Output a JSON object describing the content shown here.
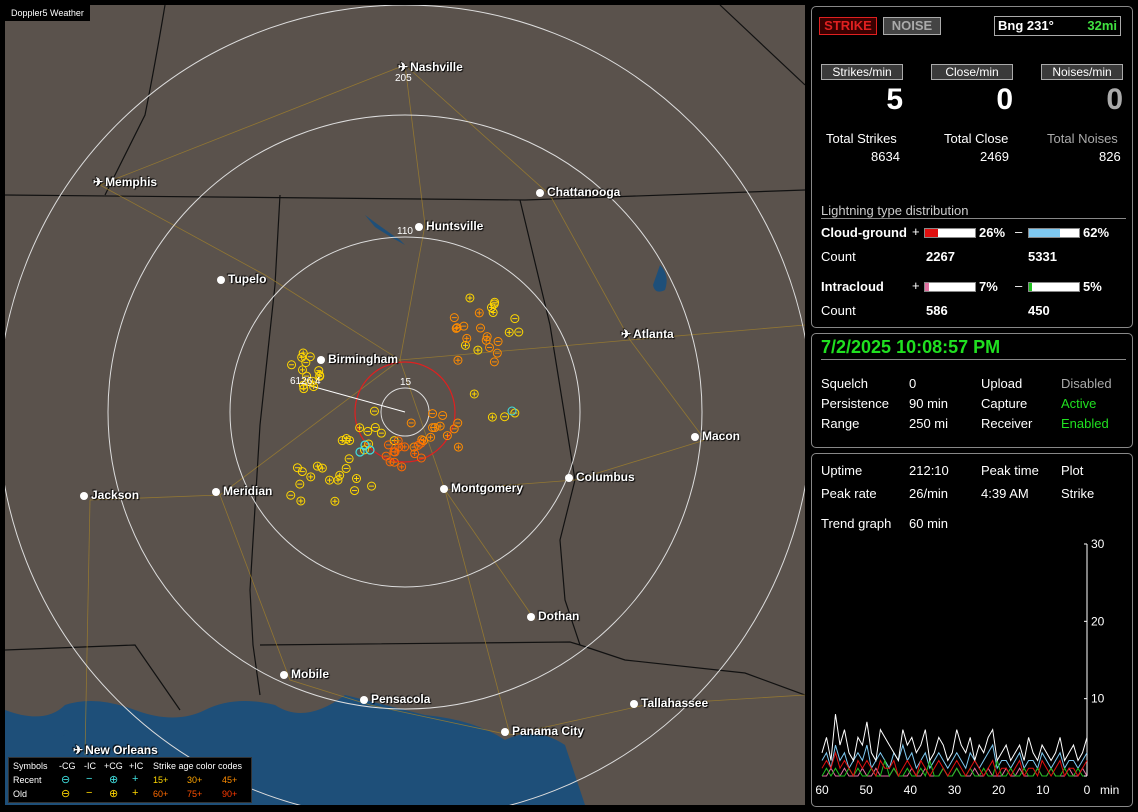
{
  "map": {
    "title": "Doppler5 Weather",
    "cities": [
      {
        "name": "Nashville",
        "kind": "airport"
      },
      {
        "name": "Memphis",
        "kind": "airport"
      },
      {
        "name": "Chattanooga",
        "kind": "city"
      },
      {
        "name": "Huntsville",
        "kind": "city"
      },
      {
        "name": "Tupelo",
        "kind": "city"
      },
      {
        "name": "Atlanta",
        "kind": "airport"
      },
      {
        "name": "Birmingham",
        "kind": "city"
      },
      {
        "name": "Macon",
        "kind": "city"
      },
      {
        "name": "Columbus",
        "kind": "city"
      },
      {
        "name": "Montgomery",
        "kind": "city"
      },
      {
        "name": "Meridian",
        "kind": "city"
      },
      {
        "name": "Jackson",
        "kind": "city"
      },
      {
        "name": "Dothan",
        "kind": "city"
      },
      {
        "name": "Mobile",
        "kind": "city"
      },
      {
        "name": "Pensacola",
        "kind": "city"
      },
      {
        "name": "Tallahassee",
        "kind": "city"
      },
      {
        "name": "Panama City",
        "kind": "city"
      },
      {
        "name": "New Orleans",
        "kind": "airport"
      }
    ],
    "ring_labels": [
      "205",
      "110",
      "15"
    ],
    "bearing_label": "6126.4",
    "legend": {
      "symbols": "Symbols",
      "headers": [
        "-CG",
        "-IC",
        "+CG",
        "+IC"
      ],
      "age_title": "Strike age color codes",
      "recent": "Recent",
      "old": "Old",
      "recent_ages": [
        "15+",
        "30+",
        "45+"
      ],
      "old_ages": [
        "60+",
        "75+",
        "90+"
      ],
      "age_colors": [
        "#ffd700",
        "#ffa500",
        "#ff8c00",
        "#ff6a00",
        "#ff5000",
        "#ff3a00"
      ]
    }
  },
  "status": {
    "strike_button": "STRIKE",
    "noise_button": "NOISE",
    "bearing": "Bng 231°",
    "distance": "32mi",
    "strikes_per_min_label": "Strikes/min",
    "close_per_min_label": "Close/min",
    "noises_per_min_label": "Noises/min",
    "strikes_per_min": "5",
    "close_per_min": "0",
    "noises_per_min": "0",
    "total_strikes_label": "Total Strikes",
    "total_close_label": "Total Close",
    "total_noises_label": "Total Noises",
    "total_strikes": "8634",
    "total_close": "2469",
    "total_noises": "826"
  },
  "distribution": {
    "title": "Lightning type distribution",
    "cloud_ground_label": "Cloud-ground",
    "intracloud_label": "Intracloud",
    "count_label": "Count",
    "plus": "+",
    "minus": "–",
    "cg_pos_pct_text": "26%",
    "cg_neg_pct_text": "62%",
    "ic_pos_pct_text": "7%",
    "ic_neg_pct_text": "5%",
    "cg_pos_pct": 26,
    "cg_neg_pct": 62,
    "ic_pos_pct": 7,
    "ic_neg_pct": 5,
    "cg_pos_count": "2267",
    "cg_neg_count": "5331",
    "ic_pos_count": "586",
    "ic_neg_count": "450",
    "colors": {
      "cg_pos": "#e01010",
      "cg_neg": "#7ec8f0",
      "ic_pos": "#e070a0",
      "ic_neg": "#20c020"
    }
  },
  "settings": {
    "datetime": "7/2/2025 10:08:57 PM",
    "squelch_label": "Squelch",
    "squelch": "0",
    "persistence_label": "Persistence",
    "persistence": "90 min",
    "range_label": "Range",
    "range": "250 mi",
    "upload_label": "Upload",
    "upload": "Disabled",
    "capture_label": "Capture",
    "capture": "Active",
    "receiver_label": "Receiver",
    "receiver": "Enabled"
  },
  "stats": {
    "uptime_label": "Uptime",
    "uptime": "212:10",
    "peak_time_label": "Peak time",
    "peak_time": "4:39 AM",
    "plot_label": "Plot",
    "plot": "Strike",
    "peak_rate_label": "Peak rate",
    "peak_rate": "26/min",
    "trend_label": "Trend graph",
    "trend": "60 min",
    "y_ticks": [
      "30",
      "20",
      "10",
      "0"
    ],
    "x_ticks": [
      "60",
      "50",
      "40",
      "30",
      "20",
      "10",
      "0"
    ],
    "x_unit": "min"
  },
  "chart_data": {
    "type": "line",
    "title": "",
    "xlabel": "min",
    "ylabel": "",
    "x_range": [
      60,
      0
    ],
    "ylim": [
      0,
      30
    ],
    "series": [
      {
        "color": "#ffffff",
        "values": [
          3,
          5,
          2,
          8,
          4,
          6,
          3,
          2,
          5,
          4,
          7,
          3,
          2,
          6,
          5,
          4,
          3,
          2,
          6,
          4,
          5,
          3,
          4,
          6,
          2,
          3,
          5,
          4,
          2,
          3,
          6,
          4,
          3,
          5,
          2,
          4,
          3,
          5,
          6,
          2,
          3,
          4,
          2,
          3,
          4,
          2,
          5,
          3,
          2,
          4,
          3,
          2,
          3,
          5,
          2,
          3,
          4,
          2,
          3,
          5
        ]
      },
      {
        "color": "#e01010",
        "values": [
          1,
          2,
          1,
          3,
          1,
          2,
          1,
          0,
          2,
          1,
          2,
          1,
          0,
          2,
          1,
          1,
          2,
          0,
          1,
          2,
          1,
          0,
          2,
          1,
          0,
          1,
          2,
          1,
          0,
          1,
          2,
          1,
          0,
          1,
          2,
          1,
          0,
          1,
          2,
          0,
          1,
          1,
          0,
          1,
          2,
          0,
          1,
          1,
          0,
          2,
          1,
          0,
          1,
          2,
          0,
          1,
          1,
          0,
          1,
          2
        ]
      },
      {
        "color": "#20c020",
        "values": [
          0,
          1,
          0,
          1,
          0,
          0,
          1,
          0,
          1,
          0,
          0,
          1,
          0,
          0,
          2,
          0,
          1,
          0,
          0,
          1,
          0,
          0,
          1,
          0,
          2,
          0,
          0,
          1,
          0,
          0,
          1,
          0,
          0,
          1,
          0,
          0,
          1,
          0,
          0,
          2,
          0,
          0,
          1,
          0,
          0,
          1,
          0,
          0,
          1,
          0,
          0,
          1,
          0,
          0,
          1,
          0,
          0,
          1,
          0,
          0
        ]
      },
      {
        "color": "#7ec8f0",
        "values": [
          2,
          3,
          1,
          4,
          2,
          3,
          1,
          2,
          3,
          2,
          4,
          1,
          2,
          3,
          2,
          1,
          3,
          2,
          4,
          2,
          3,
          1,
          2,
          3,
          1,
          2,
          3,
          2,
          1,
          2,
          3,
          2,
          1,
          3,
          2,
          1,
          2,
          3,
          4,
          1,
          2,
          2,
          1,
          2,
          3,
          1,
          2,
          2,
          1,
          3,
          2,
          1,
          2,
          3,
          1,
          2,
          2,
          1,
          2,
          3
        ]
      },
      {
        "color": "#e070a0",
        "values": [
          0,
          0,
          1,
          0,
          0,
          1,
          0,
          0,
          0,
          1,
          0,
          0,
          1,
          0,
          0,
          0,
          1,
          0,
          0,
          0,
          1,
          0,
          0,
          1,
          0,
          0,
          0,
          1,
          0,
          0,
          1,
          0,
          0,
          0,
          1,
          0,
          0,
          1,
          0,
          0,
          0,
          1,
          0,
          0,
          1,
          0,
          0,
          0,
          1,
          0,
          0,
          1,
          0,
          0,
          0,
          1,
          0,
          0,
          1,
          0
        ]
      }
    ]
  }
}
